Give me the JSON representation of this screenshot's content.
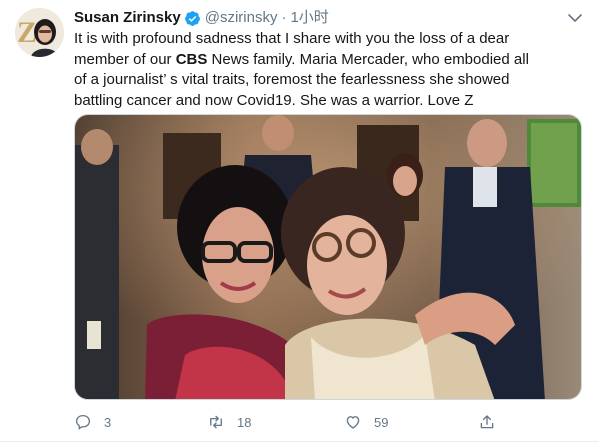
{
  "tweet": {
    "display_name": "Susan Zirinsky",
    "handle": "@szirinsky",
    "separator": "·",
    "time": "1小时",
    "text_lines": [
      "It is with profound sadness that I share with you the loss of a dear",
      "member of our ",
      "CBS",
      " News family.  Maria Mercader, who embodied all",
      "of a journalist’ s vital traits, foremost the fearlessness she showed",
      "battling cancer and now Covid19.  She was a warrior. Love Z"
    ],
    "icons": {
      "avatar": "avatar-photo",
      "verified": "verified-badge-icon",
      "more": "chevron-down-icon"
    },
    "media": {
      "alt": "photo-two-women-hugging"
    },
    "actions": {
      "reply_count": "3",
      "retweet_count": "18",
      "like_count": "59"
    },
    "colors": {
      "text": "#14171a",
      "secondary": "#657786",
      "verified": "#1da1f2",
      "border": "#e6ecf0"
    }
  }
}
